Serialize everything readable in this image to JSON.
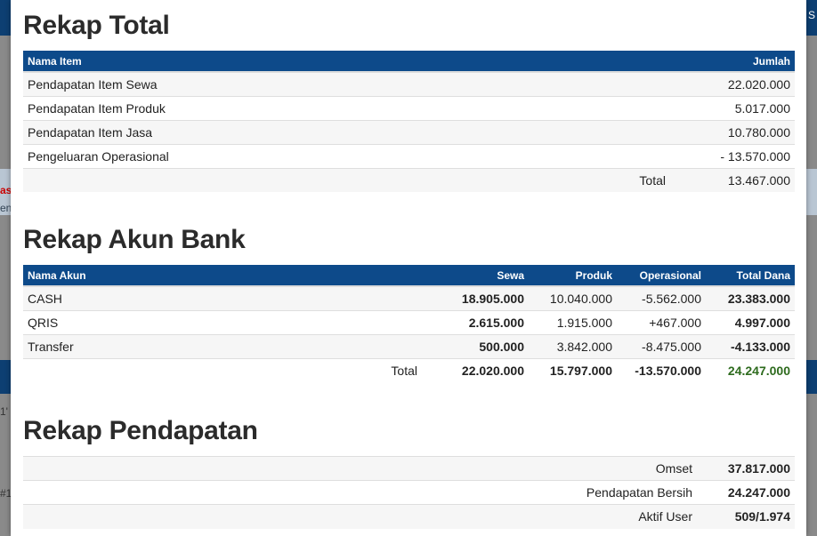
{
  "colors": {
    "header_bg": "#0d4a8a",
    "total_dana_highlight": "#2e6b1e"
  },
  "rekap_total": {
    "title": "Rekap Total",
    "headers": [
      "Nama Item",
      "Jumlah"
    ],
    "rows": [
      {
        "name": "Pendapatan Item Sewa",
        "value": "22.020.000"
      },
      {
        "name": "Pendapatan Item Produk",
        "value": "5.017.000"
      },
      {
        "name": "Pendapatan Item Jasa",
        "value": "10.780.000"
      },
      {
        "name": "Pengeluaran Operasional",
        "value": "- 13.570.000"
      }
    ],
    "total_label": "Total",
    "total_value": "13.467.000"
  },
  "rekap_bank": {
    "title": "Rekap Akun Bank",
    "headers": [
      "Nama Akun",
      "Sewa",
      "Produk",
      "Operasional",
      "Total Dana"
    ],
    "rows": [
      {
        "name": "CASH",
        "sewa": "18.905.000",
        "produk": "10.040.000",
        "operasional": "-5.562.000",
        "total": "23.383.000"
      },
      {
        "name": "QRIS",
        "sewa": "2.615.000",
        "produk": "1.915.000",
        "operasional": "+467.000",
        "total": "4.997.000"
      },
      {
        "name": "Transfer",
        "sewa": "500.000",
        "produk": "3.842.000",
        "operasional": "-8.475.000",
        "total": "-4.133.000"
      }
    ],
    "total_label": "Total",
    "total_sewa": "22.020.000",
    "total_produk": "15.797.000",
    "total_operasional": "-13.570.000",
    "total_dana": "24.247.000"
  },
  "rekap_pendapatan": {
    "title": "Rekap Pendapatan",
    "rows": [
      {
        "label": "Omset",
        "value": "37.817.000"
      },
      {
        "label": "Pendapatan Bersih",
        "value": "24.247.000"
      },
      {
        "label": "Aktif User",
        "value": "509/1.974"
      }
    ]
  },
  "background_fragments": {
    "top_right": "S",
    "left_red": "as",
    "left_gray": "en",
    "left_num_1": "1'",
    "left_num_2": "#1"
  }
}
